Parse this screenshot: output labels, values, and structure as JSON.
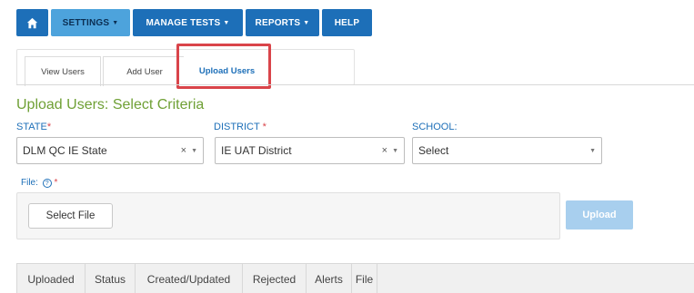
{
  "nav": {
    "home_icon": "home-icon",
    "items": [
      {
        "label": "SETTINGS",
        "active": true
      },
      {
        "label": "MANAGE TESTS",
        "active": false
      },
      {
        "label": "REPORTS",
        "active": false
      },
      {
        "label": "HELP",
        "active": false
      }
    ]
  },
  "subtabs": [
    "View Users",
    "Add User",
    "Upload Users"
  ],
  "active_subtab": "Upload Users",
  "page_title": "Upload Users: Select Criteria",
  "state": {
    "label": "STATE",
    "value": "DLM QC IE State",
    "required": true
  },
  "district": {
    "label": "DISTRICT",
    "value": "IE UAT District",
    "required": true
  },
  "school": {
    "label": "SCHOOL:",
    "value": "Select"
  },
  "file": {
    "label": "File:",
    "help_glyph": "?",
    "required_mark": "*",
    "select_label": "Select File",
    "upload_label": "Upload"
  },
  "table": {
    "headers": [
      "Uploaded",
      "Status",
      "Created/Updated",
      "Rejected",
      "Alerts",
      "File"
    ]
  },
  "colors": {
    "nav": "#1d6fb8",
    "nav_active": "#4da3dc",
    "title": "#6fa035",
    "highlight": "#d9444a",
    "upload_disabled": "#a8cfee"
  }
}
